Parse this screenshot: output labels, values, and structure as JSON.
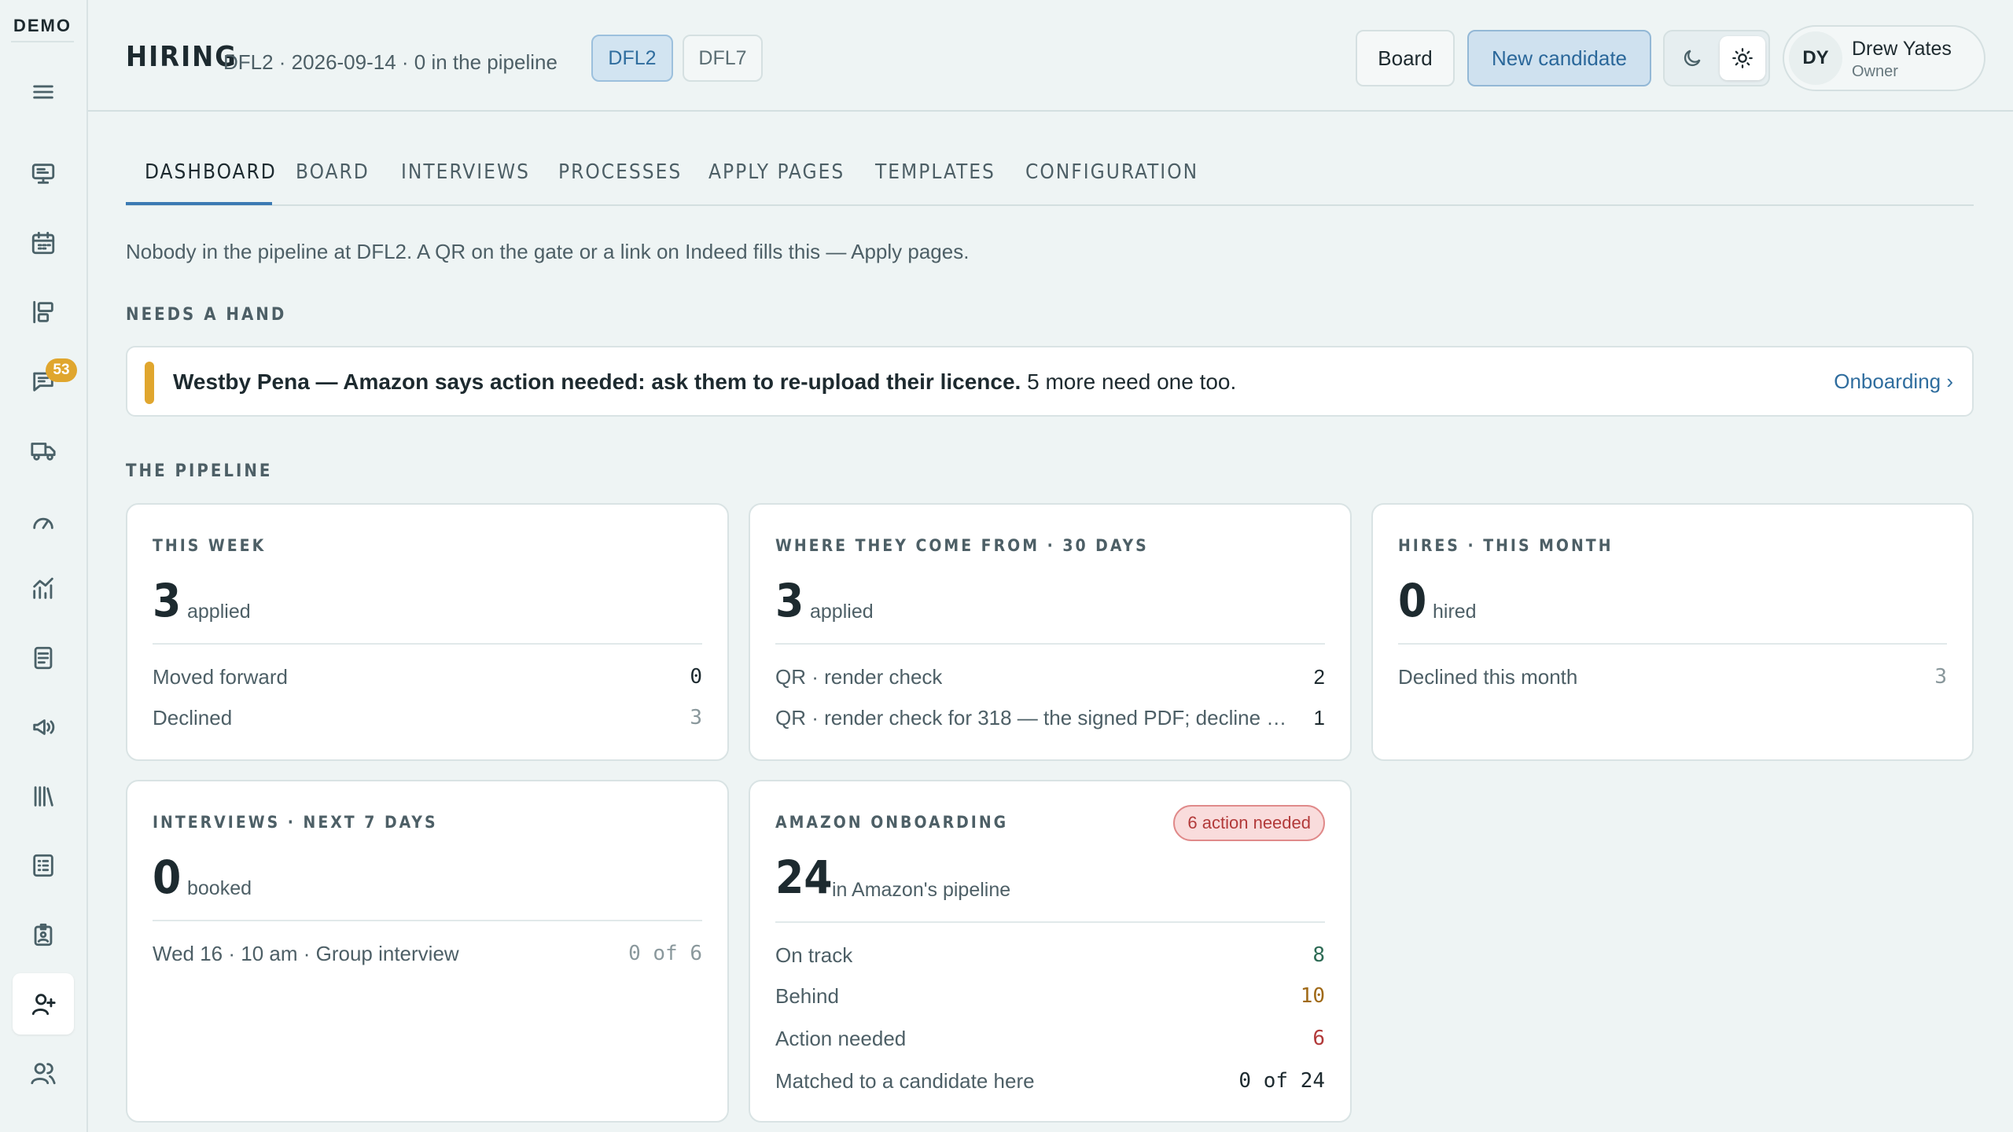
{
  "sidebar": {
    "logo": "DEMO",
    "badge_count": "53",
    "icons": [
      "menu-icon",
      "monitor-icon",
      "calendar-icon",
      "board-icon",
      "chat-icon",
      "truck-icon",
      "gauge-icon",
      "chart-icon",
      "document-icon",
      "megaphone-icon",
      "library-icon",
      "checklist-icon",
      "badge-icon",
      "user-plus-icon",
      "users-icon"
    ]
  },
  "header": {
    "title": "HIRING",
    "subtitle": "DFL2 · 2026-09-14 · 0 in the pipeline",
    "sites": [
      "DFL2",
      "DFL7"
    ],
    "board_label": "Board",
    "new_candidate_label": "New candidate",
    "user": {
      "initials": "DY",
      "name": "Drew Yates",
      "role": "Owner"
    }
  },
  "tabs": [
    "DASHBOARD",
    "BOARD",
    "INTERVIEWS",
    "PROCESSES",
    "APPLY PAGES",
    "TEMPLATES",
    "CONFIGURATION"
  ],
  "intro": "Nobody in the pipeline at DFL2. A QR on the gate or a link on Indeed fills this — Apply pages.",
  "needs_hand": {
    "label": "NEEDS A HAND",
    "alert_bold": "Westby Pena — Amazon says action needed: ask them to re-upload their licence.",
    "alert_rest": " 5 more need one too.",
    "alert_link": "Onboarding ›"
  },
  "pipeline_label": "THE PIPELINE",
  "cards": {
    "this_week": {
      "label": "THIS WEEK",
      "big": "3",
      "sub": "applied",
      "rows": [
        {
          "label": "Moved forward",
          "value": "0"
        },
        {
          "label": "Declined",
          "value": "3"
        }
      ]
    },
    "sources": {
      "label": "WHERE THEY COME FROM · 30 DAYS",
      "big": "3",
      "sub": "applied",
      "rows": [
        {
          "label": "QR · render check",
          "value": "2"
        },
        {
          "label": "QR · render check for 318 — the signed PDF; decline a...",
          "value": "1"
        }
      ]
    },
    "hires": {
      "label": "HIRES · THIS MONTH",
      "big": "0",
      "sub": "hired",
      "rows": [
        {
          "label": "Declined this month",
          "value": "3"
        }
      ]
    },
    "interviews": {
      "label": "INTERVIEWS · NEXT 7 DAYS",
      "big": "0",
      "sub": "booked",
      "rows": [
        {
          "label": "Wed 16 · 10 am · Group interview",
          "value": "0 of 6"
        }
      ]
    },
    "onboarding": {
      "label": "AMAZON ONBOARDING",
      "pill": "6 action needed",
      "big": "24",
      "sub": "in Amazon's pipeline",
      "rows": [
        {
          "label": "On track",
          "value": "8"
        },
        {
          "label": "Behind",
          "value": "10"
        },
        {
          "label": "Action needed",
          "value": "6"
        },
        {
          "label": "Matched to a candidate here",
          "value": "0 of 24"
        }
      ]
    }
  },
  "colors": {
    "accent": "#3b7ab3",
    "warning": "#e0a62e",
    "danger": "#b23a3a",
    "good": "#2e6b55",
    "behind": "#a06a18"
  }
}
